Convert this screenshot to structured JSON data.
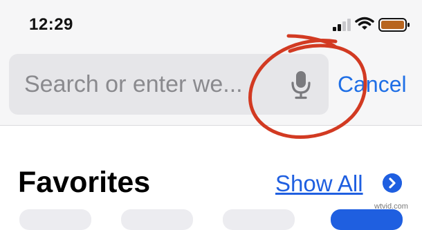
{
  "status_bar": {
    "time": "12:29"
  },
  "search": {
    "placeholder_text": "Search or enter we..."
  },
  "cancel_label": "Cancel",
  "favorites": {
    "title": "Favorites",
    "show_all_label": "Show All"
  },
  "watermark": "wtvid.com",
  "colors": {
    "accent": "#1f6fe6",
    "annotation": "#d23a22",
    "battery_fill": "#b8651f"
  },
  "icons": [
    "signal-icon",
    "wifi-icon",
    "battery-icon",
    "microphone-icon",
    "chevron-right-icon"
  ]
}
